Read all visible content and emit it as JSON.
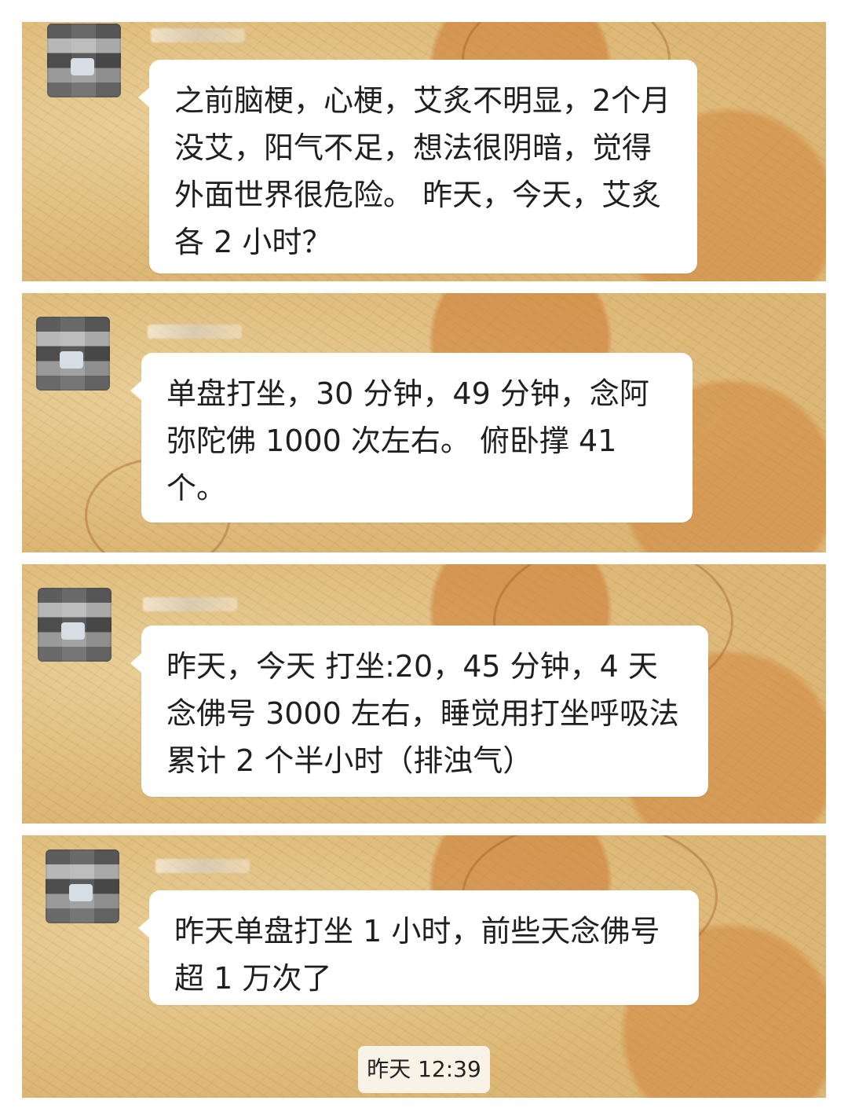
{
  "messages": [
    {
      "text": "之前脑梗，心梗，艾炙不明显，2个月没艾，阳气不足，想法很阴暗，觉得外面世界很危险。 昨天，今天，艾炙各 2 小时？"
    },
    {
      "text": "单盘打坐，30 分钟，49 分钟，念阿弥陀佛 1000 次左右。 俯卧撑 41 个。"
    },
    {
      "text": "昨天，今天 打坐:20，45 分钟，4 天念佛号 3000 左右，睡觉用打坐呼吸法累计 2 个半小时（排浊气）"
    },
    {
      "text": "昨天单盘打坐 1 小时，前些天念佛号超 1 万次了"
    }
  ],
  "timestamp": "昨天 12:39"
}
